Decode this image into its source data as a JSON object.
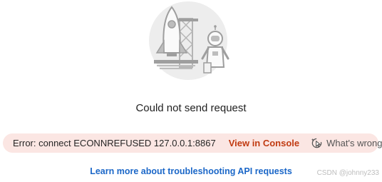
{
  "title": "Could not send request",
  "error": {
    "message": "Error: connect ECONNREFUSED 127.0.0.1:8867",
    "console_link": "View in Console",
    "whats_wrong": "What's wrong?",
    "whats_wrong_icon": "sparkle-cursor-icon"
  },
  "learn_link": "Learn more about troubleshooting API requests",
  "watermark": "CSDN @johnny233",
  "colors": {
    "error_bg": "#fbe6e3",
    "console_link": "#c13b12",
    "learn_link": "#1b67c8"
  }
}
